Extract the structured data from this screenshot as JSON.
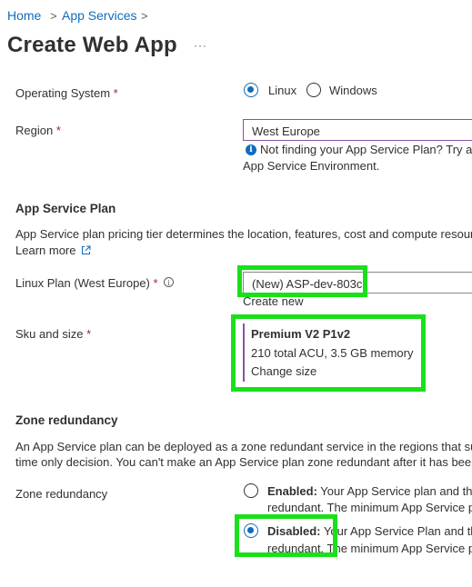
{
  "breadcrumb": {
    "home": "Home",
    "app_services": "App Services",
    "separator": ">"
  },
  "page": {
    "title": "Create Web App",
    "more": "···"
  },
  "os": {
    "label": "Operating System",
    "required": "*",
    "options": [
      {
        "label": "Linux",
        "selected": true
      },
      {
        "label": "Windows",
        "selected": false
      }
    ]
  },
  "region": {
    "label": "Region",
    "required": "*",
    "value": "West Europe",
    "info_line1": "Not finding your App Service Plan? Try a",
    "info_line2": "App Service Environment."
  },
  "plan_section": {
    "heading": "App Service Plan",
    "desc": "App Service plan pricing tier determines the location, features, cost and compute resour",
    "learn_more": "Learn more",
    "linux_plan_label": "Linux Plan (West Europe)",
    "required": "*",
    "linux_plan_value": "(New) ASP-dev-803c",
    "create_new": "Create new",
    "sku_label": "Sku and size",
    "sku_name": "Premium V2 P1v2",
    "sku_detail": "210 total ACU, 3.5 GB memory",
    "change_size": "Change size"
  },
  "zone": {
    "heading": "Zone redundancy",
    "desc_line1": "An App Service plan can be deployed as a zone redundant service in the regions that su",
    "desc_line2": "time only decision. You can't make an App Service plan zone redundant after it has been",
    "label": "Zone redundancy",
    "enabled_title": "Enabled:",
    "enabled_text1": " Your App Service plan and the",
    "enabled_text2": "redundant. The minimum App Service p",
    "disabled_title": "Disabled:",
    "disabled_text1": " Your App Service Plan and th",
    "disabled_text2": "redundant. The minimum App Service p",
    "selected": "disabled"
  },
  "colors": {
    "accent": "#0f6cbd",
    "highlight": "#19e019",
    "required": "#a4262c",
    "focus": "#8a52a5"
  }
}
